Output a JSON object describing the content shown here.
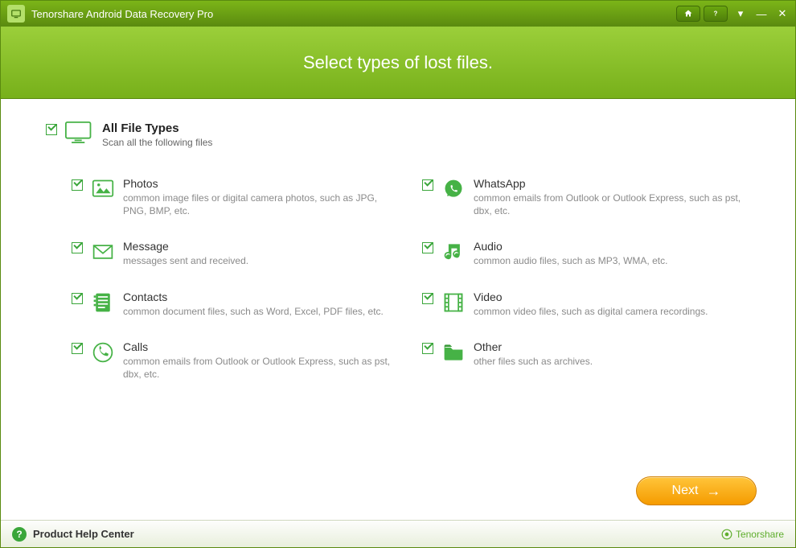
{
  "titlebar": {
    "title": "Tenorshare Android Data Recovery Pro"
  },
  "header": {
    "heading": "Select types of lost files."
  },
  "all": {
    "title": "All File Types",
    "subtitle": "Scan all the following files"
  },
  "types": {
    "photos": {
      "name": "Photos",
      "desc": "common image files or digital camera photos, such as JPG, PNG, BMP, etc."
    },
    "message": {
      "name": "Message",
      "desc": "messages sent and received."
    },
    "contacts": {
      "name": "Contacts",
      "desc": "common document files, such as Word, Excel, PDF files, etc."
    },
    "calls": {
      "name": "Calls",
      "desc": "common emails from Outlook or Outlook Express, such as pst, dbx, etc."
    },
    "whatsapp": {
      "name": "WhatsApp",
      "desc": "common emails from Outlook or Outlook Express, such as pst, dbx, etc."
    },
    "audio": {
      "name": "Audio",
      "desc": "common audio files, such as MP3, WMA, etc."
    },
    "video": {
      "name": "Video",
      "desc": "common video files, such as digital camera recordings."
    },
    "other": {
      "name": "Other",
      "desc": "other files such as archives."
    }
  },
  "buttons": {
    "next": "Next"
  },
  "footer": {
    "help": "Product Help Center",
    "brand": "Tenorshare"
  }
}
